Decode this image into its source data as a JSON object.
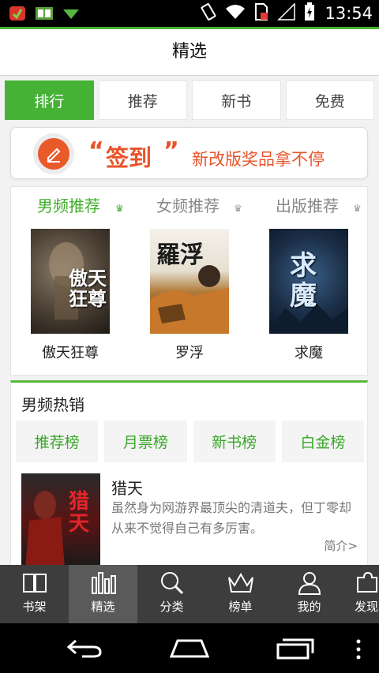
{
  "status_bar": {
    "time": "13:54",
    "left_icons": [
      "app-notification-icon",
      "book-notification-icon",
      "download-arrow-icon"
    ],
    "right_icons": [
      "vibrate-icon",
      "wifi-icon",
      "no-sim-icon",
      "signal-icon",
      "battery-charging-icon"
    ]
  },
  "header": {
    "title": "精选"
  },
  "tabs": [
    {
      "label": "排行",
      "active": true
    },
    {
      "label": "推荐",
      "active": false
    },
    {
      "label": "新书",
      "active": false
    },
    {
      "label": "免费",
      "active": false
    }
  ],
  "banner": {
    "open_quote": "“",
    "keyword": "签到",
    "close_quote": "”",
    "slogan": "新改版奖品拿不停",
    "icon": "pencil-icon"
  },
  "recommend": {
    "tabs": [
      {
        "label": "男频推荐",
        "active": true
      },
      {
        "label": "女频推荐",
        "active": false
      },
      {
        "label": "出版推荐",
        "active": false
      }
    ],
    "crown_glyph": "♛",
    "books": [
      {
        "name": "傲天狂尊",
        "cover_text": "傲天狂尊"
      },
      {
        "name": "罗浮",
        "cover_text": "羅浮"
      },
      {
        "name": "求魔",
        "cover_text": "求魔"
      }
    ]
  },
  "hot": {
    "title": "男频热销",
    "ranks": [
      "推荐榜",
      "月票榜",
      "新书榜",
      "白金榜"
    ],
    "featured": {
      "title": "猎天",
      "cover_text": "猎天",
      "description": "虽然身为网游界最顶尖的清道夫，但丁零却从来不觉得自己有多厉害。",
      "more": "简介>"
    }
  },
  "bottom_nav": [
    {
      "label": "书架",
      "icon": "book-icon",
      "active": false
    },
    {
      "label": "精选",
      "icon": "bars-icon",
      "active": true
    },
    {
      "label": "分类",
      "icon": "search-icon",
      "active": false
    },
    {
      "label": "榜单",
      "icon": "crown-icon",
      "active": false
    },
    {
      "label": "我的",
      "icon": "person-icon",
      "active": false
    },
    {
      "label": "发现",
      "icon": "puzzle-icon",
      "active": false
    }
  ],
  "colors": {
    "accent": "#45b236",
    "banner_orange": "#e8532a",
    "nav_bg": "#3d3d3d"
  }
}
